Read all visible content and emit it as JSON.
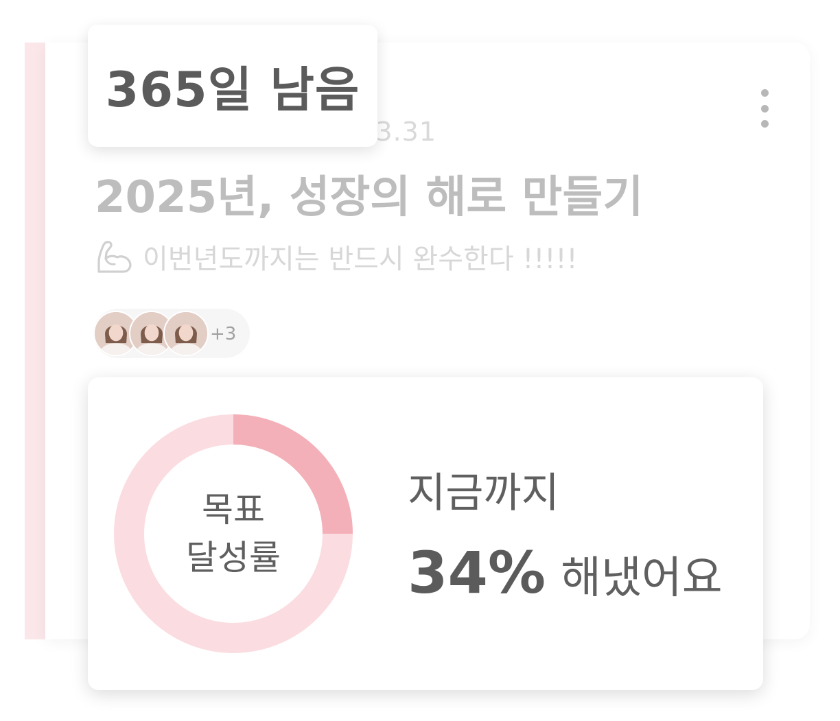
{
  "goal": {
    "period": "2025.01.01 - 2025.03.31",
    "title": "2025년, 성장의 해로 만들기",
    "motto": "이번년도까지는 반드시 완수한다 !!!!!",
    "motto_icon": "flexed-arm-icon",
    "more_icon": "more-vertical-icon"
  },
  "members": {
    "extra_count": "+3"
  },
  "dday_badge": {
    "label": "365일 남음"
  },
  "achievement": {
    "donut_label_line1": "목표",
    "donut_label_line2": "달성률",
    "so_far_label": "지금까지",
    "percent_text": "34%",
    "result_suffix": "해냈어요",
    "donut_fill_percent": 25
  },
  "colors": {
    "accent": "#f4b0b8",
    "track": "#fbdce1",
    "side_bar": "#fbe6e9"
  }
}
